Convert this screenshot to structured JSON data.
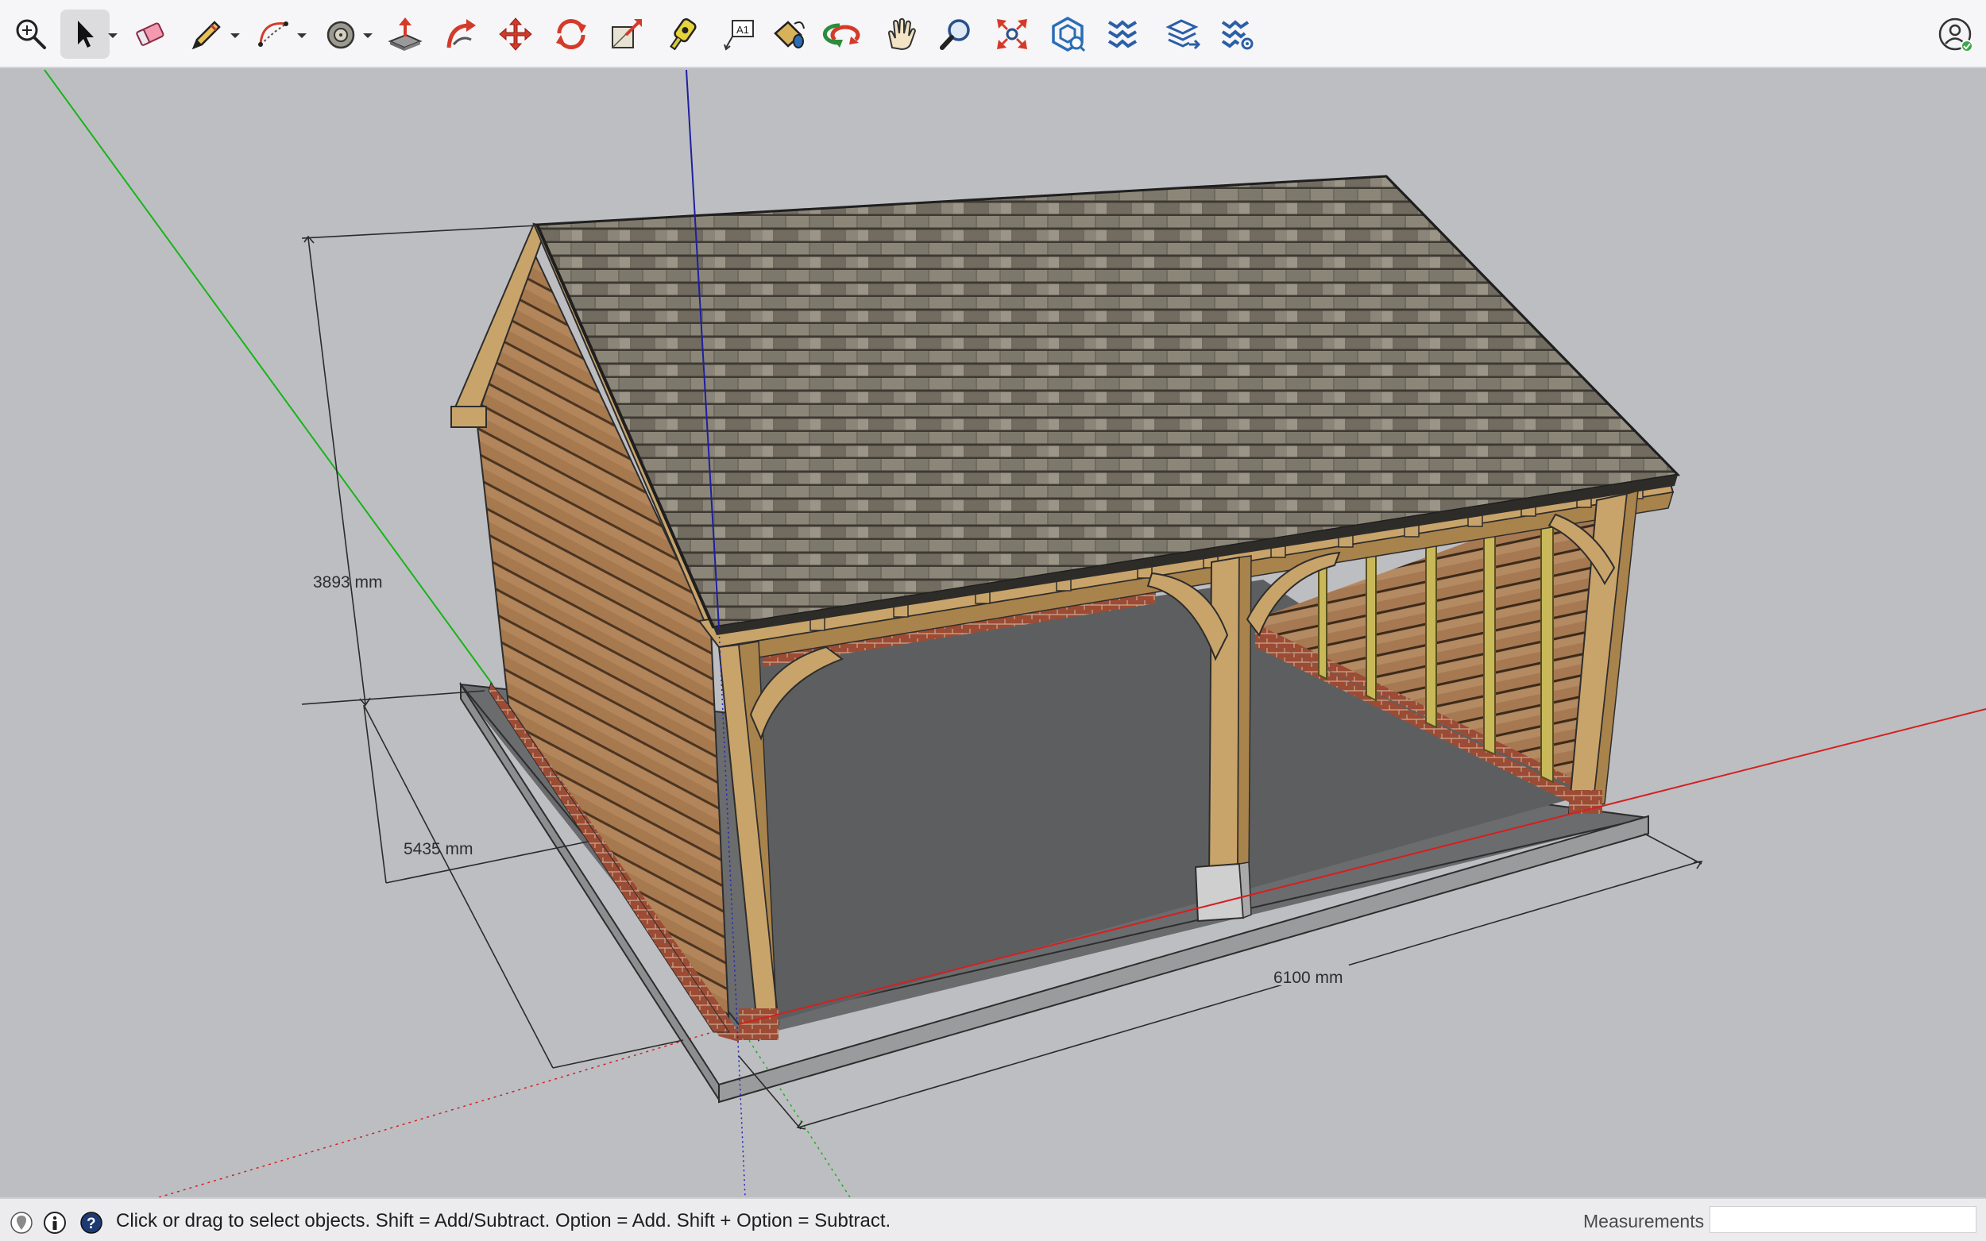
{
  "toolbar": {
    "tools": [
      {
        "name": "zoom-extents-tool",
        "label": "Zoom Extents"
      },
      {
        "name": "select-tool",
        "label": "Select",
        "active": true
      },
      {
        "name": "eraser-tool",
        "label": "Eraser"
      },
      {
        "name": "line-tool",
        "label": "Line"
      },
      {
        "name": "arc-tool",
        "label": "Arc"
      },
      {
        "name": "paint-bucket-tool",
        "label": "Paint Bucket"
      },
      {
        "name": "push-pull-tool",
        "label": "Push/Pull"
      },
      {
        "name": "follow-me-tool",
        "label": "Follow Me"
      },
      {
        "name": "move-tool",
        "label": "Move"
      },
      {
        "name": "rotate-tool",
        "label": "Rotate"
      },
      {
        "name": "scale-tool",
        "label": "Scale"
      },
      {
        "name": "tape-measure-tool",
        "label": "Tape Measure"
      },
      {
        "name": "text-tool",
        "label": "Text"
      },
      {
        "name": "paint-tool",
        "label": "Paint"
      },
      {
        "name": "orbit-tool",
        "label": "Orbit"
      },
      {
        "name": "pan-tool",
        "label": "Pan"
      },
      {
        "name": "zoom-tool",
        "label": "Zoom"
      },
      {
        "name": "zoom-extents-arrows-tool",
        "label": "Zoom Extents"
      },
      {
        "name": "warehouse-tool",
        "label": "3D Warehouse"
      },
      {
        "name": "extension-warehouse-tool",
        "label": "Extension Warehouse"
      },
      {
        "name": "layout-send-tool",
        "label": "Send to LayOut"
      },
      {
        "name": "extension-manager-tool",
        "label": "Extension Manager"
      }
    ],
    "text_tool_glyph": "A1",
    "account": {
      "label": "Account"
    }
  },
  "viewport": {
    "dimensions": {
      "height": "3893 mm",
      "depth": "5435 mm",
      "width": "6100 mm"
    }
  },
  "colors": {
    "background": "#bdbec2",
    "red_axis": "#d42020",
    "green_axis": "#18b418",
    "blue_axis": "#1f1fc0",
    "roof_tile": "#6f6a60",
    "oak_frame": "#c9a46a",
    "timber_cladding": "#a7794f",
    "brick_plinth": "#9c4b34",
    "concrete_floor": "#6a6b6d",
    "slab_edge": "#8d8e90",
    "tool_red": "#d43a2a",
    "tool_blue": "#2a6db6"
  },
  "statusbar": {
    "message": "Click or drag to select objects. Shift = Add/Subtract. Option = Add. Shift + Option = Subtract.",
    "measurements_label": "Measurements",
    "measurements_value": "",
    "icons": [
      "geo-location-icon",
      "credits-icon",
      "help-icon"
    ]
  }
}
